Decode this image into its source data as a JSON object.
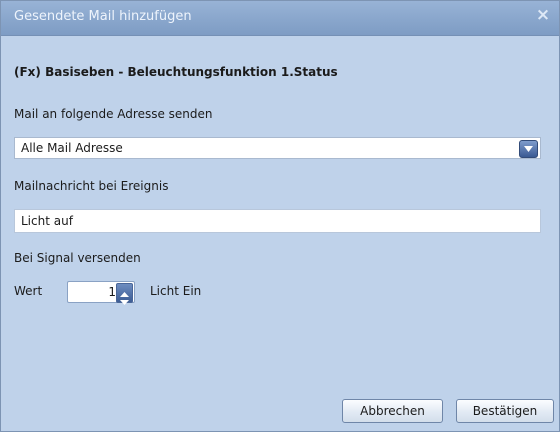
{
  "window": {
    "title": "Gesendete Mail hinzufügen",
    "close_glyph": "×"
  },
  "heading": "(Fx) Basiseben - Beleuchtungsfunktion 1.Status",
  "recipient": {
    "label": "Mail an folgende Adresse senden",
    "selected": "Alle Mail Adresse"
  },
  "message": {
    "label": "Mailnachricht bei Ereignis",
    "value": "Licht auf"
  },
  "signal": {
    "label": "Bei Signal versenden",
    "value_label": "Wert",
    "value": "1",
    "value_text": "Licht Ein"
  },
  "buttons": {
    "cancel": "Abbrechen",
    "confirm": "Bestätigen"
  },
  "colors": {
    "titlebar": "#89a6cc",
    "background": "#bfd2ea",
    "dropdown_arrow": "#3a5a93"
  }
}
